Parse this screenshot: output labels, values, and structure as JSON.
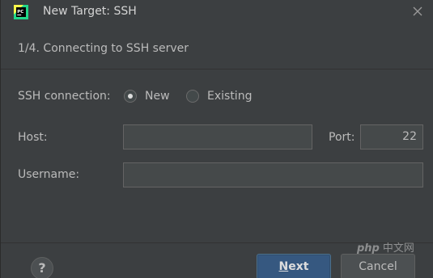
{
  "window": {
    "title": "New Target: SSH",
    "app_icon": "pycharm-pc-icon",
    "close_icon": "close-icon"
  },
  "step": {
    "text": "1/4. Connecting to SSH server"
  },
  "form": {
    "ssh_connection_label": "SSH connection:",
    "radio_new_label": "New",
    "radio_new_checked": true,
    "radio_existing_label": "Existing",
    "radio_existing_checked": false,
    "host_label": "Host:",
    "host_value": "",
    "port_label": "Port:",
    "port_value": "22",
    "username_label": "Username:",
    "username_value": ""
  },
  "footer": {
    "help_label": "?",
    "next_mnemonic": "N",
    "next_rest": "ext",
    "cancel_label": "Cancel"
  },
  "watermark": {
    "badge": "php",
    "text": "中文网"
  },
  "colors": {
    "background": "#3c3f41",
    "input_bg": "#45494a",
    "primary_button": "#365880",
    "text": "#bbbbbb"
  }
}
